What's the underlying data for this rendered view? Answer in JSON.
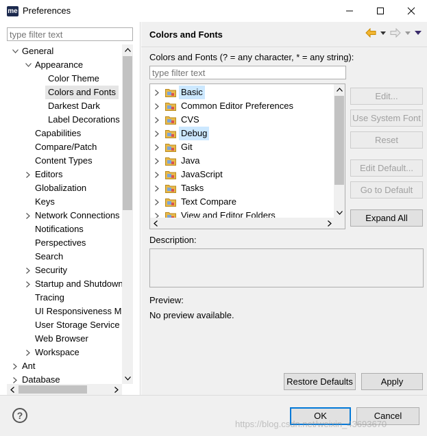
{
  "window": {
    "app_icon_text": "me",
    "title": "Preferences"
  },
  "left": {
    "filter_placeholder": "type filter text",
    "tree": [
      {
        "label": "General",
        "level": 0,
        "expanded": true
      },
      {
        "label": "Appearance",
        "level": 1,
        "expanded": true
      },
      {
        "label": "Color Theme",
        "level": 2
      },
      {
        "label": "Colors and Fonts",
        "level": 2,
        "selected": true
      },
      {
        "label": "Darkest Dark",
        "level": 2
      },
      {
        "label": "Label Decorations",
        "level": 2
      },
      {
        "label": "Capabilities",
        "level": 1
      },
      {
        "label": "Compare/Patch",
        "level": 1
      },
      {
        "label": "Content Types",
        "level": 1
      },
      {
        "label": "Editors",
        "level": 1,
        "collapsed": true
      },
      {
        "label": "Globalization",
        "level": 1
      },
      {
        "label": "Keys",
        "level": 1
      },
      {
        "label": "Network Connections",
        "level": 1,
        "collapsed": true
      },
      {
        "label": "Notifications",
        "level": 1
      },
      {
        "label": "Perspectives",
        "level": 1
      },
      {
        "label": "Search",
        "level": 1
      },
      {
        "label": "Security",
        "level": 1,
        "collapsed": true
      },
      {
        "label": "Startup and Shutdown",
        "level": 1,
        "collapsed": true
      },
      {
        "label": "Tracing",
        "level": 1
      },
      {
        "label": "UI Responsiveness Monitoring",
        "level": 1
      },
      {
        "label": "User Storage Service",
        "level": 1
      },
      {
        "label": "Web Browser",
        "level": 1
      },
      {
        "label": "Workspace",
        "level": 1,
        "collapsed": true
      },
      {
        "label": "Ant",
        "level": 0,
        "collapsed": true
      },
      {
        "label": "Database",
        "level": 0,
        "collapsed": true
      }
    ]
  },
  "page": {
    "title": "Colors and Fonts",
    "hint": "Colors and Fonts (? = any character, * = any string):",
    "filter_placeholder": "type filter text",
    "categories": [
      {
        "label": "Basic",
        "highlight": true
      },
      {
        "label": "Common Editor Preferences"
      },
      {
        "label": "CVS"
      },
      {
        "label": "Debug",
        "highlight": true
      },
      {
        "label": "Git"
      },
      {
        "label": "Java"
      },
      {
        "label": "JavaScript"
      },
      {
        "label": "Tasks"
      },
      {
        "label": "Text Compare"
      },
      {
        "label": "View and Editor Folders"
      }
    ],
    "buttons": {
      "edit": "Edit...",
      "use_system_font": "Use System Font",
      "reset": "Reset",
      "edit_default": "Edit Default...",
      "go_to_default": "Go to Default",
      "expand_all": "Expand All"
    },
    "description_label": "Description:",
    "preview_label": "Preview:",
    "preview_text": "No preview available.",
    "restore_defaults": "Restore Defaults",
    "apply": "Apply"
  },
  "footer": {
    "ok": "OK",
    "cancel": "Cancel",
    "watermark": "https://blog.csdn.net/weixin_43693670"
  },
  "colors": {
    "selection": "#cce8ff",
    "folder": "#e8b94a",
    "accent": "#0078d7"
  }
}
